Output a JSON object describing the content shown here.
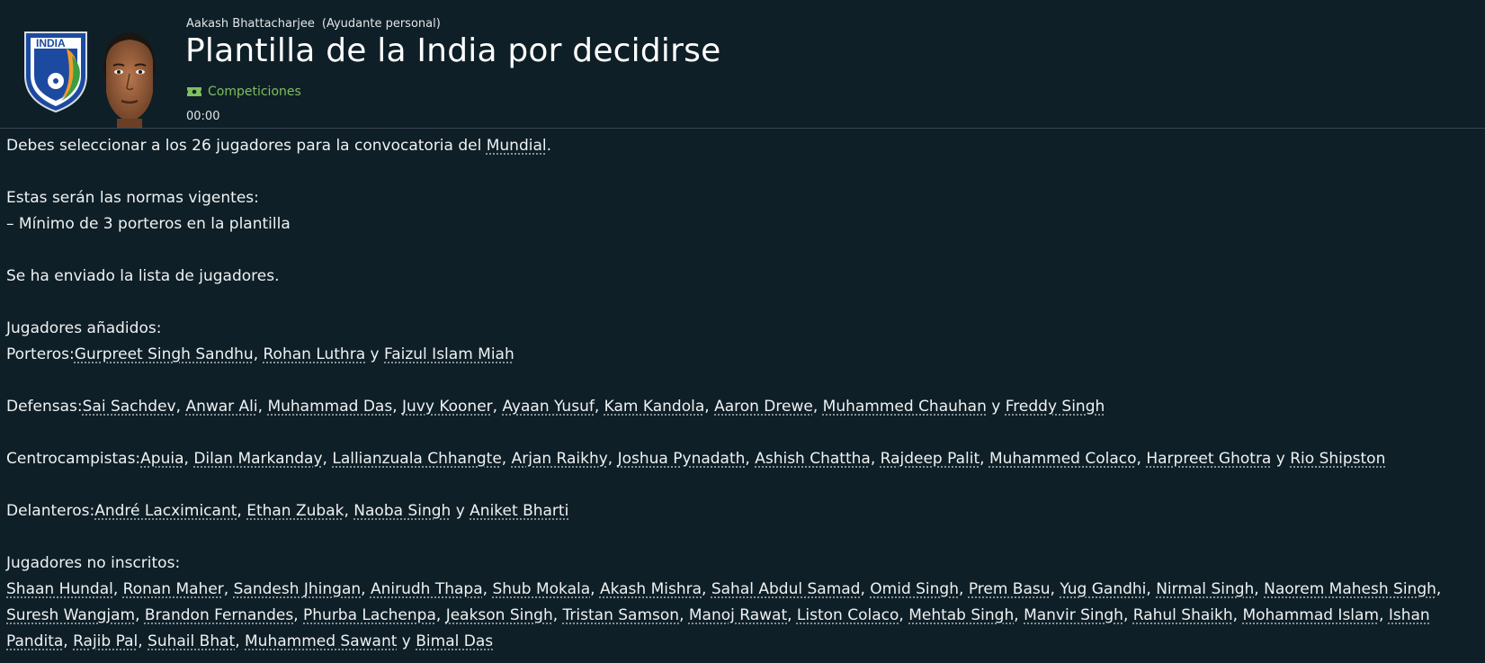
{
  "header": {
    "sender_name": "Aakash Bhattacharjee",
    "sender_role": "(Ayudante personal)",
    "title": "Plantilla de la India por decidirse",
    "tag_label": "Competiciones",
    "tag_icon": "ticket-icon",
    "time": "00:00",
    "crest_text": "INDIA"
  },
  "message": {
    "intro_before": "Debes seleccionar a los 26 jugadores para la convocatoria del ",
    "intro_link": "Mundial",
    "intro_after": ".",
    "rules_title": "Estas serán las normas vigentes:",
    "rule_1": "– Mínimo de 3 porteros en la plantilla",
    "sent": "Se ha enviado la lista de jugadores.",
    "added_title": "Jugadores añadidos:",
    "groups": [
      {
        "label": "Porteros:",
        "players": [
          "Gurpreet Singh Sandhu",
          "Rohan Luthra",
          "Faizul Islam Miah"
        ]
      },
      {
        "label": "Defensas:",
        "players": [
          "Sai Sachdev",
          "Anwar Ali",
          "Muhammad Das",
          "Juvy Kooner",
          "Ayaan Yusuf",
          "Kam Kandola",
          "Aaron Drewe",
          "Muhammed Chauhan",
          "Freddy Singh"
        ]
      },
      {
        "label": "Centrocampistas:",
        "players": [
          "Apuia",
          "Dilan Markanday",
          "Lallianzuala Chhangte",
          "Arjan Raikhy",
          "Joshua Pynadath",
          "Ashish Chattha",
          "Rajdeep Palit",
          "Muhammed Colaco",
          "Harpreet Ghotra",
          "Rio Shipston"
        ]
      },
      {
        "label": "Delanteros:",
        "players": [
          "André Lacximicant",
          "Ethan Zubak",
          "Naoba Singh",
          "Aniket Bharti"
        ]
      }
    ],
    "not_registered_title": "Jugadores no inscritos:",
    "not_registered": [
      "Shaan Hundal",
      "Ronan Maher",
      "Sandesh Jhingan",
      "Anirudh Thapa",
      "Shub Mokala",
      "Akash Mishra",
      "Sahal Abdul Samad",
      "Omid Singh",
      "Prem Basu",
      "Yug Gandhi",
      "Nirmal Singh",
      "Naorem Mahesh Singh",
      "Suresh Wangjam",
      "Brandon Fernandes",
      "Phurba Lachenpa",
      "Jeakson Singh",
      "Tristan Samson",
      "Manoj Rawat",
      "Liston Colaco",
      "Mehtab Singh",
      "Manvir Singh",
      "Rahul Shaikh",
      "Mohammad Islam",
      "Ishan Pandita",
      "Rajib Pal",
      "Suhail Bhat",
      "Muhammed Sawant",
      "Bimal Das"
    ],
    "separator": ", ",
    "conjunction": " y "
  },
  "colors": {
    "background": "#0f1f27",
    "tag": "#7fbf5e",
    "crest_blue": "#1c4aa0",
    "crest_orange": "#f29a2e",
    "crest_green": "#3b9e3f"
  }
}
